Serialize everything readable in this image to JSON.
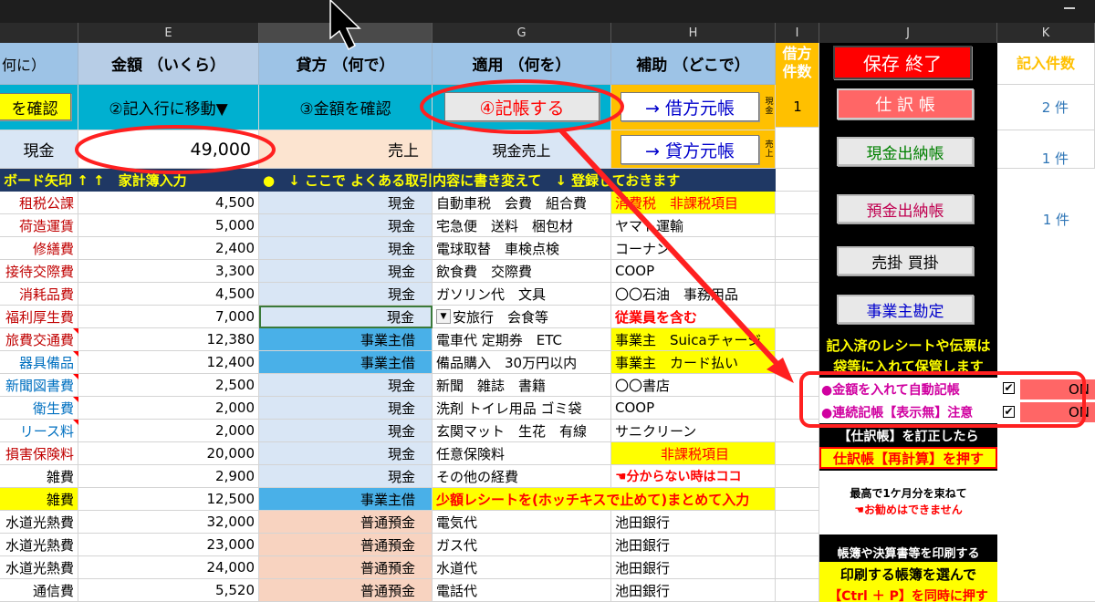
{
  "columns": [
    "E",
    "F",
    "G",
    "H",
    "I",
    "J",
    "K"
  ],
  "header_row": {
    "d": "何に）",
    "e": "金額 （いくら）",
    "f": "貸方 （何で）",
    "g": "適用 （何を）",
    "h": "補助 （どこで）",
    "i": "借方件数",
    "save_button": "保存 終了",
    "k": "記入件数"
  },
  "row2": {
    "d_button": "を確認",
    "e": "②記入行に移動▼",
    "f": "③金額を確認",
    "g_button": "④記帳する",
    "h_button": "→ 借方元帳",
    "h_tag": "現金",
    "i_value": "1",
    "j_button": "仕 訳 帳",
    "k_value": "2 件"
  },
  "row3": {
    "d": "現金",
    "e": "49,000",
    "f": "売上",
    "g": "現金売上",
    "h_button": "→ 貸方元帳",
    "h_tag": "売上",
    "j_button": "現金出納帳",
    "k_value": "1 件"
  },
  "banner": {
    "left": "ボード矢印 ↑ ↑　家計簿入力",
    "right": "●　↓ ここで よくある取引内容に書き変えて　↓ 登録しておきます"
  },
  "rows": [
    {
      "d": "租税公課",
      "e": "4,500",
      "f": "現金",
      "g": "自動車税　会費　組合費",
      "h": "消費税　非課税項目"
    },
    {
      "d": "荷造運賃",
      "e": "5,000",
      "f": "現金",
      "g": "宅急便　送料　梱包材",
      "h": "ヤマト運輸"
    },
    {
      "d": "修繕費",
      "e": "2,400",
      "f": "現金",
      "g": "電球取替　車検点検",
      "h": "コーナン"
    },
    {
      "d": "接待交際費",
      "e": "3,300",
      "f": "現金",
      "g": "飲食費　交際費",
      "h": "COOP"
    },
    {
      "d": "消耗品費",
      "e": "4,500",
      "f": "現金",
      "g": "ガソリン代　文具",
      "h": "〇〇石油　事務用品"
    },
    {
      "d": "福利厚生費",
      "e": "7,000",
      "f": "現金",
      "g": "安旅行　会食等",
      "h": "従業員を含む"
    },
    {
      "d": "旅費交通費",
      "e": "12,380",
      "f": "事業主借",
      "g": "電車代 定期券　ETC",
      "h": "事業主　Suicaチャージ"
    },
    {
      "d": "器具備品",
      "e": "12,400",
      "f": "事業主借",
      "g": "備品購入　30万円以内",
      "h": "事業主　カード払い"
    },
    {
      "d": "新聞図書費",
      "e": "2,500",
      "f": "現金",
      "g": "新聞　雑誌　書籍",
      "h": "〇〇書店"
    },
    {
      "d": "衛生費",
      "e": "2,000",
      "f": "現金",
      "g": "洗剤 トイレ用品 ゴミ袋",
      "h": "COOP"
    },
    {
      "d": "リース料",
      "e": "2,000",
      "f": "現金",
      "g": "玄関マット　生花　有線",
      "h": "サニクリーン"
    },
    {
      "d": "損害保険料",
      "e": "20,000",
      "f": "現金",
      "g": "任意保険料",
      "h": "非課税項目"
    },
    {
      "d": "雑費",
      "e": "2,900",
      "f": "現金",
      "g": "その他の経費",
      "h": "☚分からない時はココ"
    },
    {
      "d": "雑費",
      "e": "12,500",
      "f": "事業主借",
      "g": "少額レシートを(ホッチキスで止めて)まとめて入力",
      "h": ""
    },
    {
      "d": "水道光熱費",
      "e": "32,000",
      "f": "普通預金",
      "g": "電気代",
      "h": "池田銀行"
    },
    {
      "d": "水道光熱費",
      "e": "23,000",
      "f": "普通預金",
      "g": "ガス代",
      "h": "池田銀行"
    },
    {
      "d": "水道光熱費",
      "e": "24,000",
      "f": "普通預金",
      "g": "水道代",
      "h": "池田銀行"
    },
    {
      "d": "通信費",
      "e": "5,520",
      "f": "普通預金",
      "g": "電話代",
      "h": "池田銀行"
    }
  ],
  "side_panel": {
    "k_row3": "1 件",
    "bank_book_button": "預金出納帳",
    "ar_ap_button": "売掛 買掛",
    "owner_account_button": "事業主勘定",
    "receipt_note_1": "記入済のレシートや伝票は",
    "receipt_note_2": "袋等に入れて保管します",
    "auto_post_label": "●金額を入れて自動記帳",
    "auto_post_state": "ON",
    "continuous_label": "●連続記帳【表示無】注意",
    "continuous_state": "ON",
    "journal_fix_note": "【仕訳帳】を訂正したら",
    "recalc_note": "仕訳帳【再計算】を押す",
    "month_note_1": "最高で1ケ月分を束ねて",
    "month_note_2": "☚お勧めはできません",
    "print_note_1": "帳簿や決算書等を印刷する",
    "print_note_2": "印刷する帳簿を選んで",
    "print_note_3": "【Ctrl ＋ P】を同時に押す"
  },
  "colors": {
    "header_blue": "#9dc3e6",
    "button_yellow": "#ffff00",
    "annotation_red": "#ff0000",
    "credit_cash_blue": "#d9e6f5",
    "owner_loan_blue": "#49b0e8",
    "bank_peach": "#f8d3c0",
    "orange": "#ffc000"
  }
}
